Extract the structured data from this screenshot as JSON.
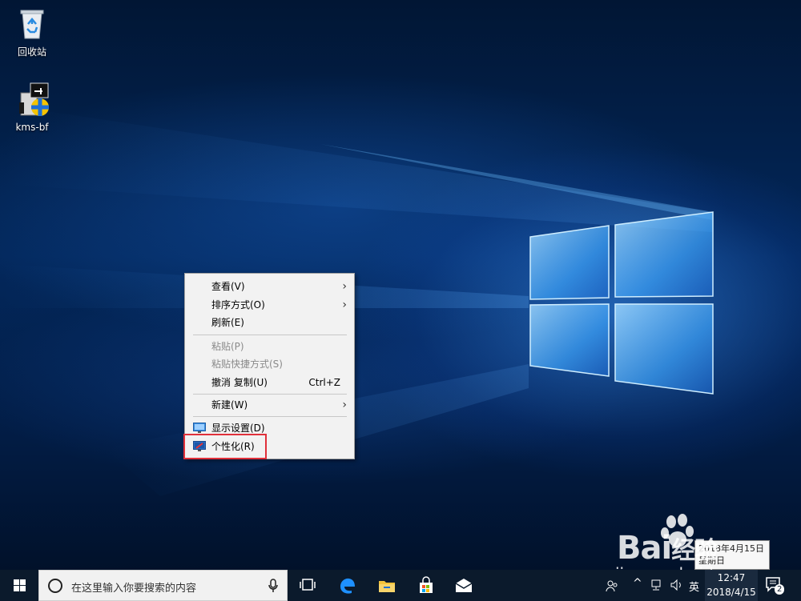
{
  "desktop": {
    "icons": [
      {
        "label": "回收站",
        "icon": "recycle-bin-icon"
      },
      {
        "label": "kms-bf",
        "icon": "kms-app-icon"
      }
    ]
  },
  "context_menu": {
    "items": [
      {
        "label": "查看(V)",
        "has_submenu": true,
        "enabled": true
      },
      {
        "label": "排序方式(O)",
        "has_submenu": true,
        "enabled": true
      },
      {
        "label": "刷新(E)",
        "enabled": true
      },
      {
        "label": "粘贴(P)",
        "enabled": false
      },
      {
        "label": "粘贴快捷方式(S)",
        "enabled": false
      },
      {
        "label": "撤消 复制(U)",
        "shortcut": "Ctrl+Z",
        "enabled": true
      },
      {
        "label": "新建(W)",
        "has_submenu": true,
        "enabled": true
      },
      {
        "label": "显示设置(D)",
        "icon": "display-settings-icon",
        "enabled": true
      },
      {
        "label": "个性化(R)",
        "icon": "personalize-icon",
        "enabled": true,
        "highlighted": true
      }
    ],
    "highlight_color": "#e0303a"
  },
  "taskbar": {
    "search_placeholder": "在这里输入你要搜索的内容",
    "pinned": [
      "task-view-icon",
      "edge-icon",
      "file-explorer-icon",
      "store-icon",
      "mail-icon"
    ],
    "tray": {
      "ime": "英",
      "time": "12:47",
      "date": "2018/4/15",
      "notification_count": "2"
    },
    "accent": "#0b1a2c"
  },
  "tooltip": {
    "line1": "2018年4月15日",
    "line2": "星期日"
  },
  "watermark": {
    "brand": "Bai",
    "brand2": "经验",
    "url": "jingyan.baidu.com"
  }
}
